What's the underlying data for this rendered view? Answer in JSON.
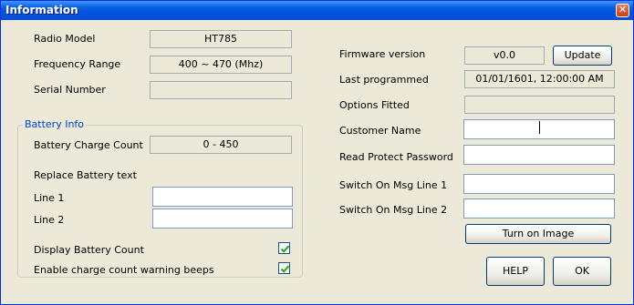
{
  "window": {
    "title": "Information",
    "close_icon": "close-icon"
  },
  "left": {
    "radio_model_label": "Radio Model",
    "radio_model_value": "HT785",
    "frequency_label": "Frequency Range",
    "frequency_value": "400 ~ 470 (Mhz)",
    "serial_label": "Serial Number",
    "serial_value": "",
    "battery_group": {
      "legend": "Battery Info",
      "charge_count_label": "Battery Charge Count",
      "charge_count_value": "0 - 450",
      "replace_text_label": "Replace Battery text",
      "line1_label": "Line 1",
      "line1_value": "",
      "line2_label": "Line 2",
      "line2_value": ""
    },
    "display_count_label": "Display Battery Count",
    "display_count_checked": true,
    "warning_beeps_label": "Enable charge count warning beeps",
    "warning_beeps_checked": true
  },
  "right": {
    "firmware_label": "Firmware version",
    "firmware_value": "v0.0",
    "update_button": "Update",
    "last_programmed_label": "Last programmed",
    "last_programmed_value": "01/01/1601, 12:00:00 AM",
    "options_label": "Options Fitted",
    "options_value": "",
    "customer_label": "Customer Name",
    "customer_value": "",
    "read_protect_label": "Read Protect Password",
    "read_protect_value": "",
    "switch_on_1_label": "Switch On Msg Line 1",
    "switch_on_1_value": "",
    "switch_on_2_label": "Switch On Msg Line 2",
    "switch_on_2_value": "",
    "turn_on_image_button": "Turn on Image",
    "help_button": "HELP",
    "ok_button": "OK"
  },
  "colors": {
    "title_bar": "#0a5fdf",
    "group_legend": "#0046d5",
    "face": "#ece9d8"
  }
}
